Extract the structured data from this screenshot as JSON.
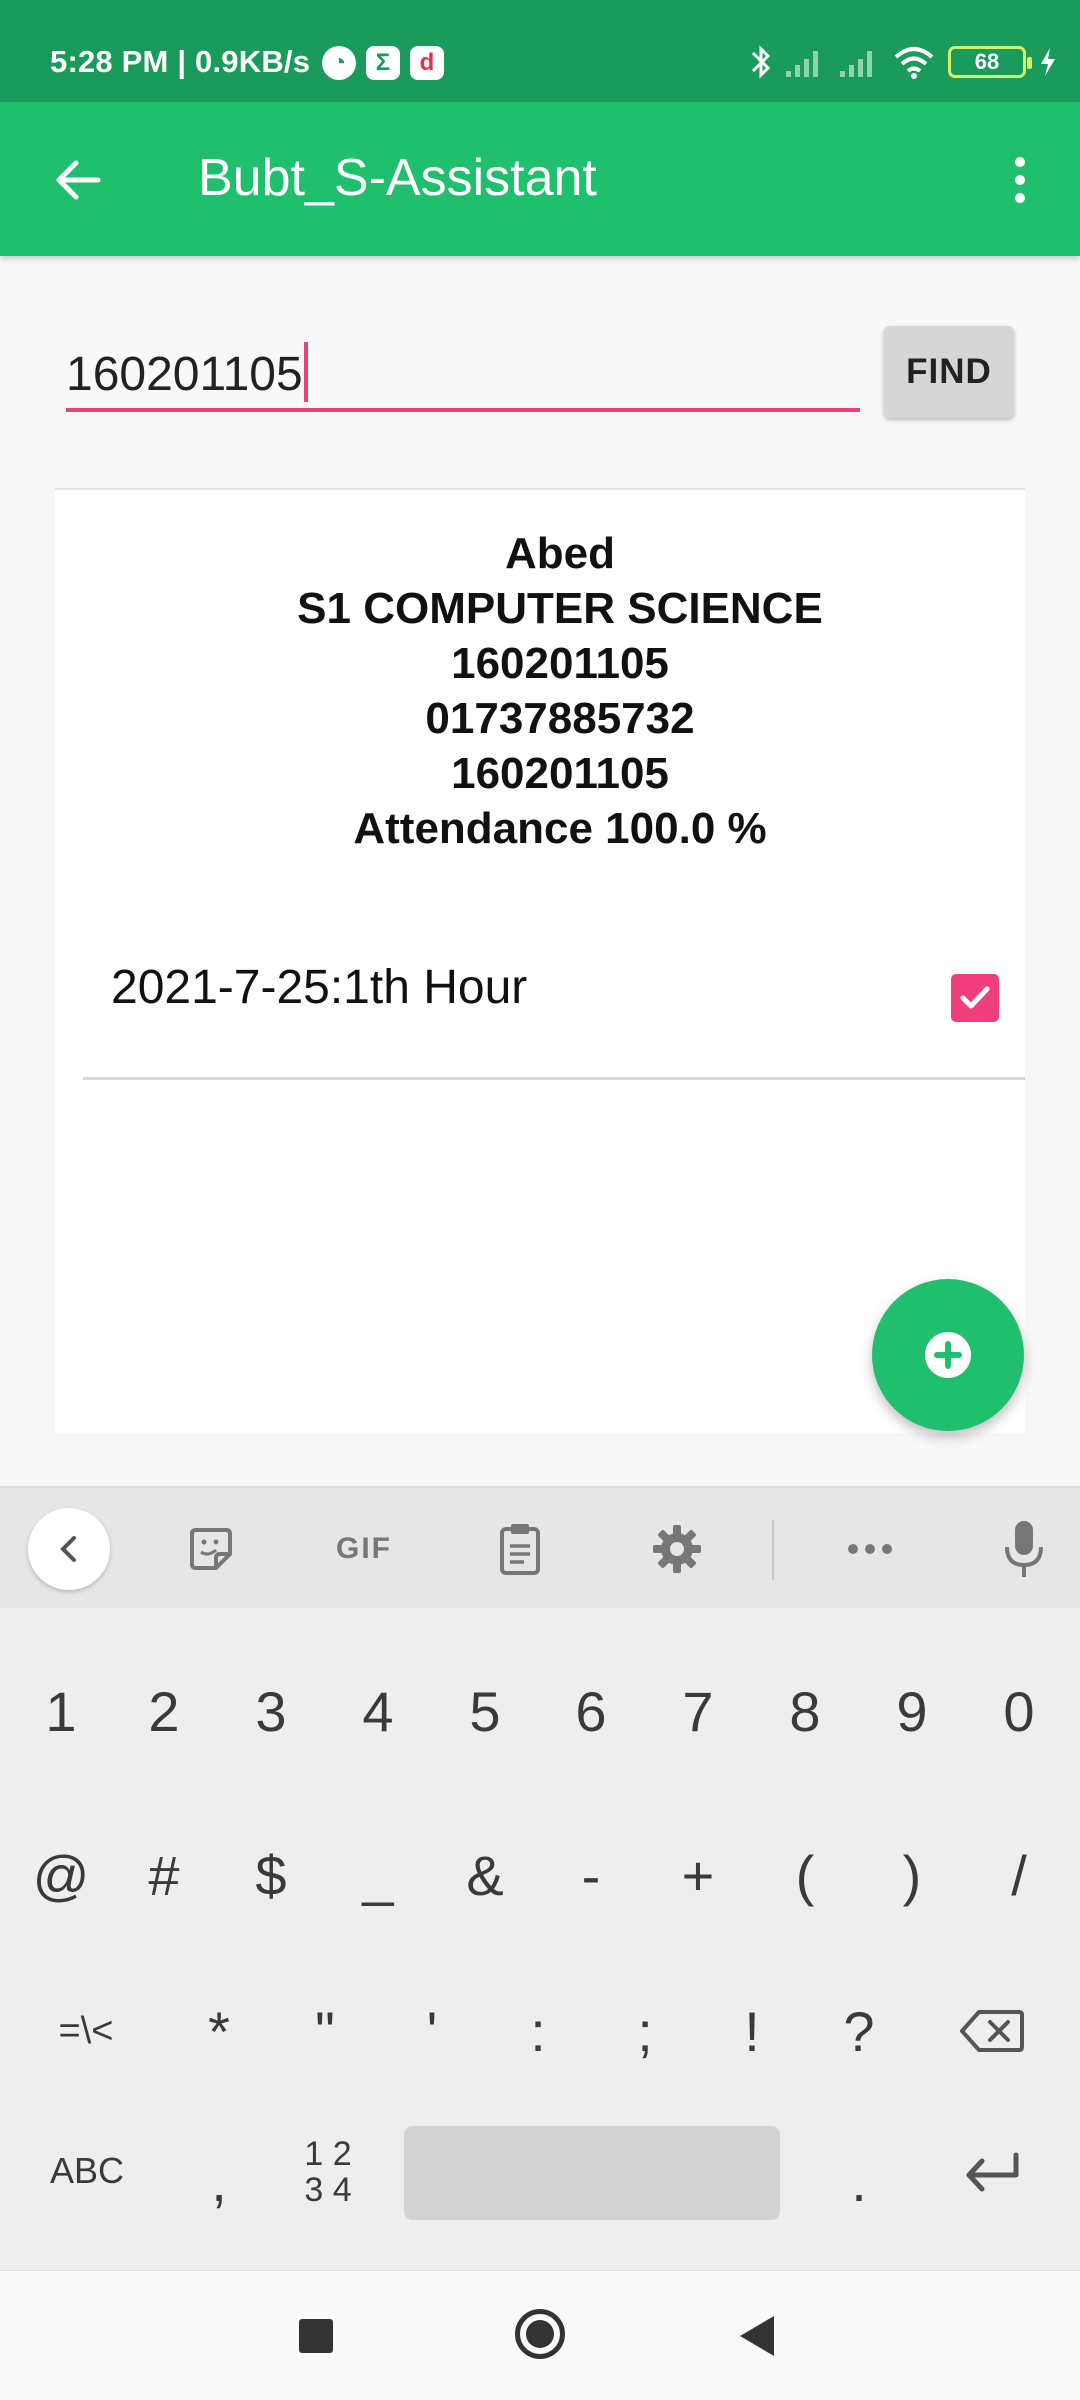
{
  "status_bar": {
    "time_speed": "5:28 PM | 0.9KB/s",
    "icons": [
      "clock-app-icon",
      "sigma-app-icon",
      "d-app-icon"
    ],
    "battery": "68"
  },
  "app_bar": {
    "title": "Bubt_S-Assistant"
  },
  "search": {
    "value": "160201105",
    "find_label": "FIND"
  },
  "student": {
    "name": "Abed",
    "class": "S1 COMPUTER SCIENCE",
    "id": "160201105",
    "phone": "01737885732",
    "roll": "160201105",
    "attendance": "Attendance 100.0 %"
  },
  "attendance_list": [
    {
      "label": "2021-7-25:1th Hour",
      "checked": true
    }
  ],
  "keyboard": {
    "toolbar_gif": "GIF",
    "row1": [
      "1",
      "2",
      "3",
      "4",
      "5",
      "6",
      "7",
      "8",
      "9",
      "0"
    ],
    "row2": [
      "@",
      "#",
      "$",
      "_",
      "&",
      "-",
      "+",
      "(",
      ")",
      "/"
    ],
    "row3": [
      "=\\<",
      "*",
      "\"",
      "'",
      ":",
      ";",
      "!",
      "?"
    ],
    "row4": {
      "abc": "ABC",
      "comma": ",",
      "numpad_top": "1 2",
      "numpad_bottom": "3 4",
      "period": "."
    }
  },
  "colors": {
    "status_bar": "#1a9a5b",
    "app_bar": "#1fbf6e",
    "accent": "#e8427c"
  }
}
